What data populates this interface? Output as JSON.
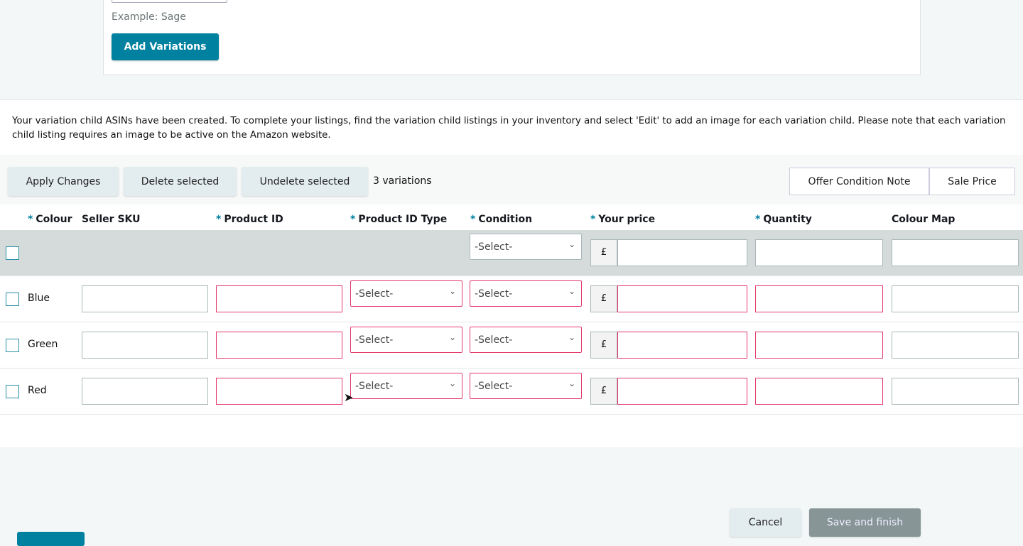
{
  "top": {
    "example_text": "Example: Sage",
    "add_variations_label": "Add Variations"
  },
  "notice": "Your variation child ASINs have been created. To complete your listings, find the variation child listings in your inventory and select 'Edit' to add an image for each variation child. Please note that each variation child listing requires an image to be active on the Amazon website.",
  "toolbar": {
    "apply": "Apply Changes",
    "delete": "Delete selected",
    "undelete": "Undelete selected",
    "count": "3 variations",
    "offer_note": "Offer Condition Note",
    "sale_price": "Sale Price"
  },
  "columns": {
    "colour": "Colour",
    "sku": "Seller SKU",
    "product_id": "Product ID",
    "product_id_type": "Product ID Type",
    "condition": "Condition",
    "price": "Your price",
    "quantity": "Quantity",
    "colour_map": "Colour Map",
    "required_mark": "*"
  },
  "select_placeholder": "-Select-",
  "currency": "£",
  "rows": [
    {
      "colour": ""
    },
    {
      "colour": "Blue"
    },
    {
      "colour": "Green"
    },
    {
      "colour": "Red"
    }
  ],
  "footer": {
    "cancel": "Cancel",
    "save": "Save and finish"
  }
}
